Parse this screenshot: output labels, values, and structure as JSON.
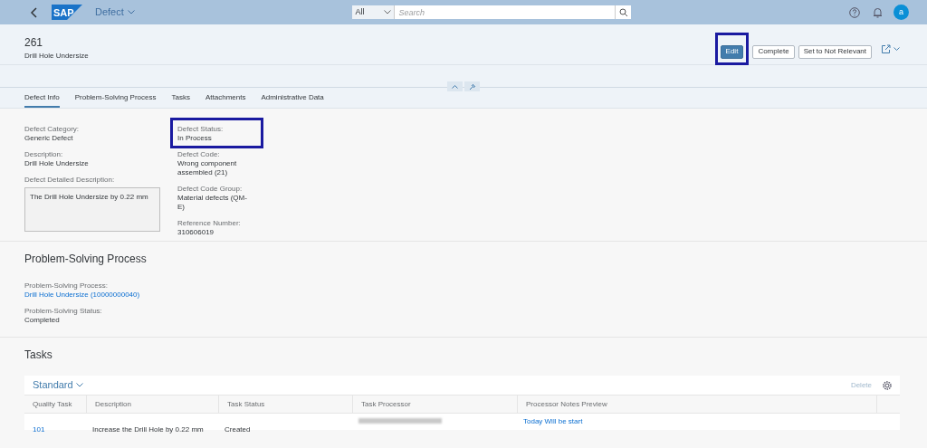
{
  "shell": {
    "logo": "SAP",
    "app_title": "Defect",
    "search_scope": "All",
    "search_placeholder": "Search",
    "avatar": "a"
  },
  "header": {
    "title": "261",
    "subtitle": "Drill Hole Undersize",
    "actions": [
      {
        "label": "Edit",
        "kind": "primary",
        "highlighted": true
      },
      {
        "label": "Complete",
        "kind": "default",
        "highlighted": false
      },
      {
        "label": "Set to Not Relevant",
        "kind": "default",
        "highlighted": false
      }
    ]
  },
  "tabs": [
    {
      "label": "Defect Info",
      "selected": true
    },
    {
      "label": "Problem-Solving Process",
      "selected": false
    },
    {
      "label": "Tasks",
      "selected": false
    },
    {
      "label": "Attachments",
      "selected": false
    },
    {
      "label": "Administrative Data",
      "selected": false
    }
  ],
  "defect_info": {
    "column_1": [
      {
        "label": "Defect Category:",
        "value": "Generic Defect",
        "highlighted": false
      },
      {
        "label": "Description:",
        "value": "Drill Hole Undersize",
        "highlighted": false
      }
    ],
    "detailed_description": {
      "label": "Defect Detailed Description:",
      "value": "The Drill Hole Undersize by 0.22 mm"
    },
    "column_2": [
      {
        "label": "Defect Status:",
        "value": "In Process",
        "highlighted": true
      },
      {
        "label": "Defect Code:",
        "value": "Wrong component assembled (21)",
        "highlighted": false
      },
      {
        "label": "Defect Code Group:",
        "value": "Material defects (QM-E)",
        "highlighted": false
      },
      {
        "label": "Reference Number:",
        "value": "310606019",
        "highlighted": false
      }
    ]
  },
  "problem_solving": {
    "title": "Problem-Solving Process",
    "fields": [
      {
        "label": "Problem-Solving Process:",
        "value": "Drill Hole Undersize (10000000040)",
        "kind": "link"
      },
      {
        "label": "Problem-Solving Status:",
        "value": "Completed",
        "kind": "text"
      }
    ]
  },
  "tasks": {
    "title": "Tasks",
    "variant": "Standard",
    "delete_label": "Delete",
    "columns": [
      "Quality Task",
      "Description",
      "Task Status",
      "Task Processor",
      "Processor Notes Preview"
    ],
    "rows": [
      {
        "quality_task": "101",
        "description": "Increase the Drill Hole by 0.22 mm",
        "task_status": "Created",
        "processor_notes": "Today Will be start"
      }
    ]
  }
}
